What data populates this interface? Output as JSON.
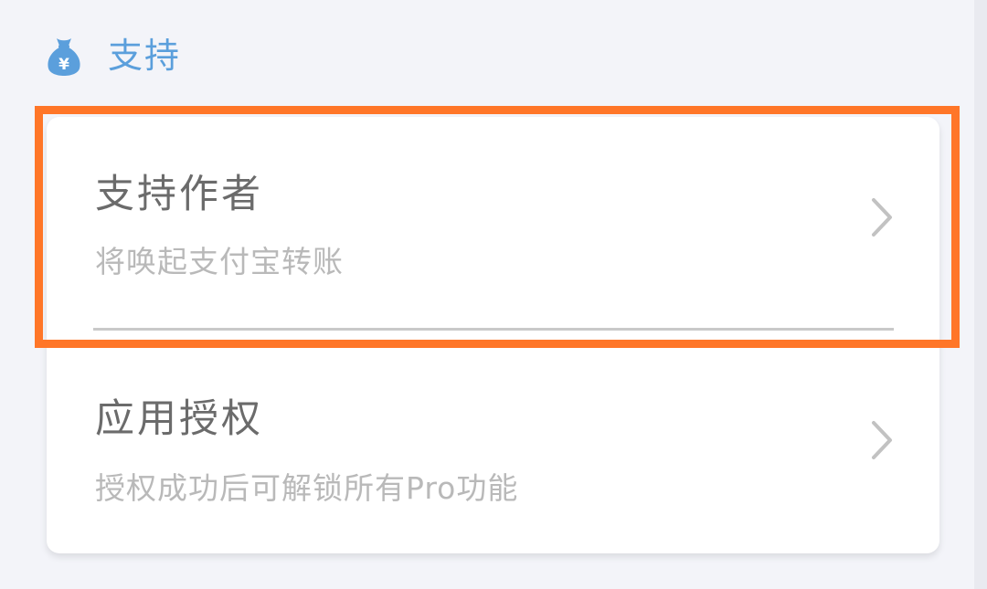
{
  "colors": {
    "accent": "#5b9fdc",
    "highlight": "#ff7628",
    "background": "#f3f4f9"
  },
  "section": {
    "icon": "money-bag-icon",
    "icon_glyph": "¥",
    "title": "支持"
  },
  "items": [
    {
      "title": "支持作者",
      "subtitle": "将唤起支付宝转账",
      "icon": "chevron-right-icon",
      "highlighted": true
    },
    {
      "title": "应用授权",
      "subtitle": "授权成功后可解锁所有Pro功能",
      "icon": "chevron-right-icon",
      "highlighted": false
    }
  ]
}
